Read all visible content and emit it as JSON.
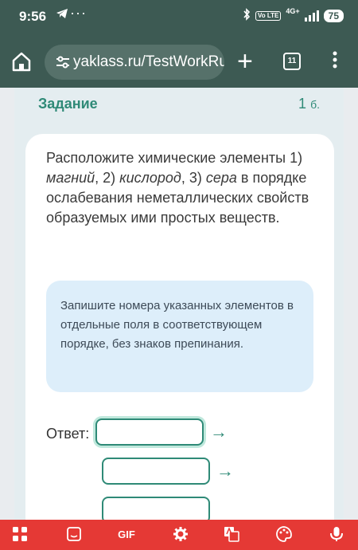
{
  "status_bar": {
    "time": "9:56",
    "dots": "···",
    "volte": "Vo LTE",
    "network": "4G+",
    "battery": "75"
  },
  "browser": {
    "url": "yaklass.ru/TestWorkRun",
    "tab_count": "11"
  },
  "task": {
    "title": "Задание",
    "score_value": "1",
    "score_unit": "б.",
    "question_part1": "Расположите химические элементы 1) ",
    "el1": "магний",
    "sep1": ", 2) ",
    "el2": "кислород",
    "sep2": ", 3) ",
    "el3": "сера",
    "question_part2": " в порядке ослабевания неметаллических свойств образуемых ими простых веществ.",
    "hint": "Запишите номера указанных элементов в отдельные поля в соответствующем порядке, без знаков препинания.",
    "answer_label": "Ответ:",
    "answer_values": [
      "",
      "",
      ""
    ],
    "arrow": "→"
  },
  "keyboard_bar": {
    "gif_label": "GIF"
  },
  "colors": {
    "accent": "#2f8a77",
    "browser_bg": "#3d5a53",
    "keyboard_bar": "#e53935",
    "hint_bg": "#ddeefa"
  }
}
